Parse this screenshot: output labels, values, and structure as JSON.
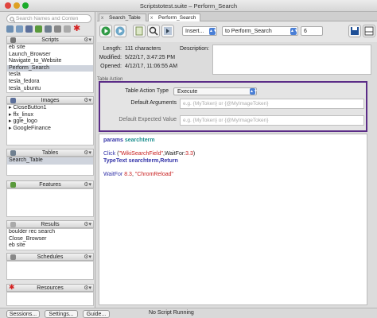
{
  "window": {
    "title": "Scriptstotest.suite – Perform_Search"
  },
  "sidebar": {
    "search_placeholder": "Search Names and Conten",
    "scripts": {
      "title": "Scripts",
      "items": [
        "eb site",
        "Launch_Browser",
        "Navigate_to_Website",
        "Perform_Search",
        "tesla",
        "tesla_fedora",
        "tesla_ubuntu"
      ],
      "selected_index": 3
    },
    "images": {
      "title": "Images",
      "items": [
        "CloseButton1",
        "ffx_linux",
        "ggle_logo",
        "GoogleFinance"
      ]
    },
    "tables": {
      "title": "Tables",
      "items": [
        "Search_Table"
      ],
      "selected_index": 0
    },
    "features": {
      "title": "Features",
      "items": []
    },
    "results": {
      "title": "Results",
      "items": [
        "boulder rec search",
        "Close_Browser",
        "eb site"
      ]
    },
    "schedules": {
      "title": "Schedules",
      "items": []
    },
    "resources": {
      "title": "Resources",
      "items": []
    }
  },
  "tabs": [
    {
      "label": "Search_Table",
      "close": "x"
    },
    {
      "label": "Perform_Search",
      "close": "x"
    }
  ],
  "toolbar": {
    "insert_label": "Insert...",
    "script_select": "to Perform_Search",
    "count_value": "6",
    "icons": [
      "run-icon",
      "run-step-icon",
      "table-icon",
      "capture-icon",
      "next-icon",
      "save-icon",
      "layout-icon"
    ]
  },
  "info": {
    "length_label": "Length:",
    "length_value": "111 characters",
    "modified_label": "Modified:",
    "modified_value": "5/22/17, 3:47:25 PM",
    "opened_label": "Opened:",
    "opened_value": "4/12/17, 11:06:55 AM",
    "description_label": "Description:"
  },
  "table_action": {
    "section_label": "Table Action",
    "type_label": "Table Action Type",
    "type_value": "Execute",
    "args_label": "Default Arguments",
    "args_placeholder": "e.g. {MyToken} or {@MyImageToken}",
    "expected_label": "Default Expected Value",
    "expected_placeholder": "e.g. {MyToken} or {@MyImageToken}"
  },
  "code": {
    "l1_kw": "params",
    "l1_id": "searchterm",
    "l2_kw": "Click",
    "l2_a": " (",
    "l2_str": "\"WikiSearchField\"",
    "l2_b": ",WaitFor:",
    "l2_num": "3.3",
    "l2_c": ")",
    "l3_kw": "TypeText",
    "l3_id": "searchterm",
    "l3_b": ",Return",
    "l4_kw": "WaitFor",
    "l4_num": " 8.3",
    "l4_b": ", ",
    "l4_str": "\"ChromReload\""
  },
  "bottom": {
    "sessions_label": "Sessions...",
    "settings_label": "Settings...",
    "guide_label": "Guide...",
    "status": "No Script Running"
  },
  "colors": {
    "highlight_border": "#5b2c87",
    "keyword": "#3333a8",
    "identifier": "#1c8f8f",
    "string": "#c81e1e"
  }
}
